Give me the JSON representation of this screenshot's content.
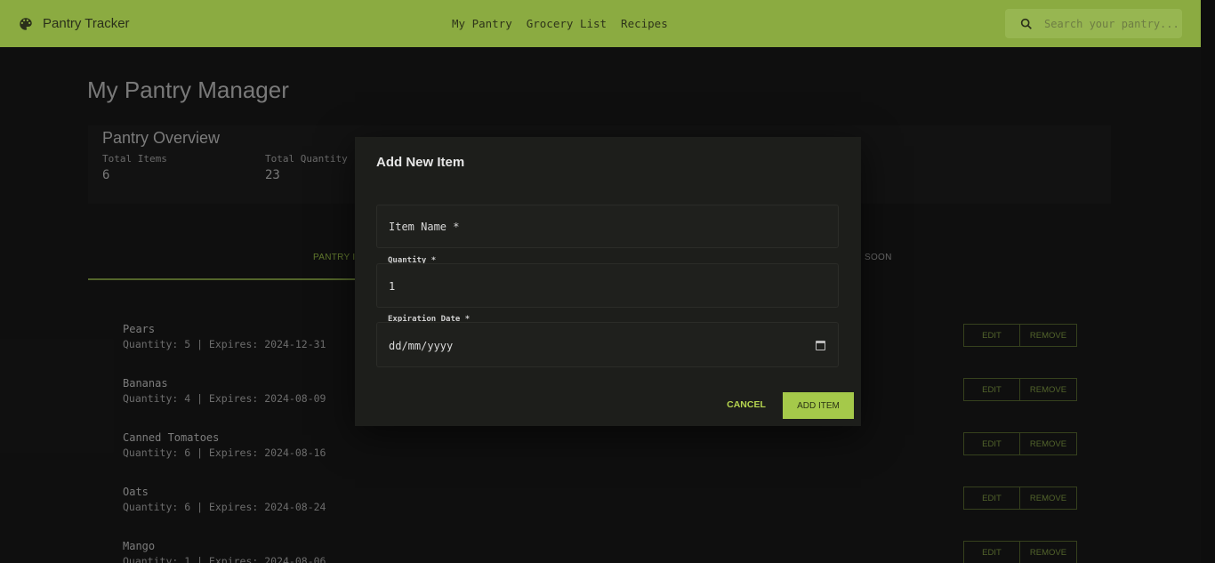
{
  "appbar": {
    "title": "Pantry Tracker",
    "nav": [
      "My Pantry",
      "Grocery List",
      "Recipes"
    ],
    "search_placeholder": "Search your pantry..."
  },
  "page": {
    "title": "My Pantry Manager"
  },
  "overview": {
    "title": "Pantry Overview",
    "stats": [
      {
        "label": "Total Items",
        "value": "6"
      },
      {
        "label": "Total Quantity",
        "value": "23"
      }
    ]
  },
  "tabs": {
    "pantry": "PANTRY IT",
    "expiring": "SOON"
  },
  "items": [
    {
      "name": "Pears",
      "meta": "Quantity: 5 | Expires: 2024-12-31"
    },
    {
      "name": "Bananas",
      "meta": "Quantity: 4 | Expires: 2024-08-09"
    },
    {
      "name": "Canned Tomatoes",
      "meta": "Quantity: 6 | Expires: 2024-08-16"
    },
    {
      "name": "Oats",
      "meta": "Quantity: 6 | Expires: 2024-08-24"
    },
    {
      "name": "Mango",
      "meta": "Quantity: 1 | Expires: 2024-08-06"
    }
  ],
  "item_actions": {
    "edit": "EDIT",
    "remove": "REMOVE"
  },
  "dialog": {
    "title": "Add New Item",
    "item_name_placeholder": "Item Name *",
    "quantity_label": "Quantity *",
    "quantity_value": "1",
    "expiration_label": "Expiration Date *",
    "expiration_placeholder": "dd/mm/yyyy",
    "cancel": "CANCEL",
    "add": "ADD ITEM"
  },
  "colors": {
    "accent": "#8bab41",
    "button": "#a5c94a"
  }
}
